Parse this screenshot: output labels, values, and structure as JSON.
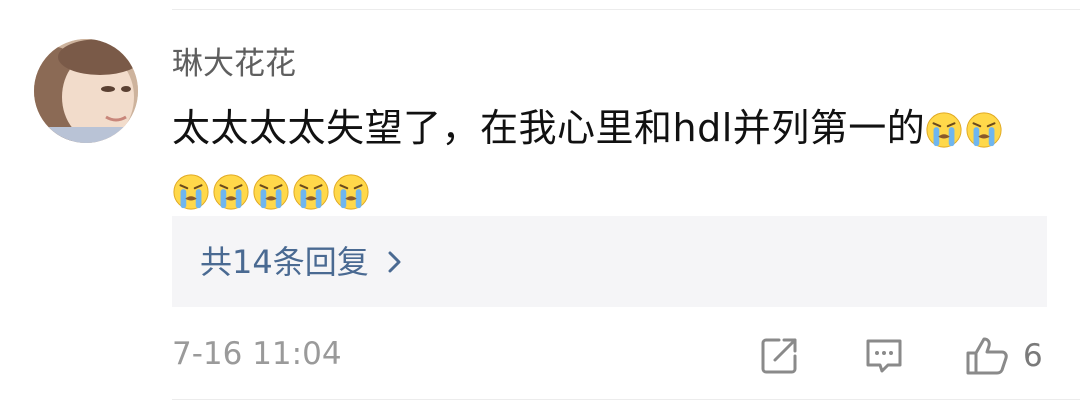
{
  "comment": {
    "username": "琳大花花",
    "text": "太太太太失望了，在我心里和hdl并列第一的",
    "emoji_name": "crying-face-emoji",
    "emoji_count_line1": 2,
    "emoji_count_line2": 5,
    "replies_link": "共14条回复",
    "timestamp": "7-16 11:04",
    "like_count": "6"
  },
  "icons": {
    "share": "share-icon",
    "reply": "comment-icon",
    "like": "thumbs-up-icon",
    "replies_chevron": "chevron-right-icon"
  },
  "colors": {
    "link": "#4a6a92",
    "username": "#5f5f5f",
    "meta": "#9a9a9a",
    "panel": "#f5f5f7"
  }
}
